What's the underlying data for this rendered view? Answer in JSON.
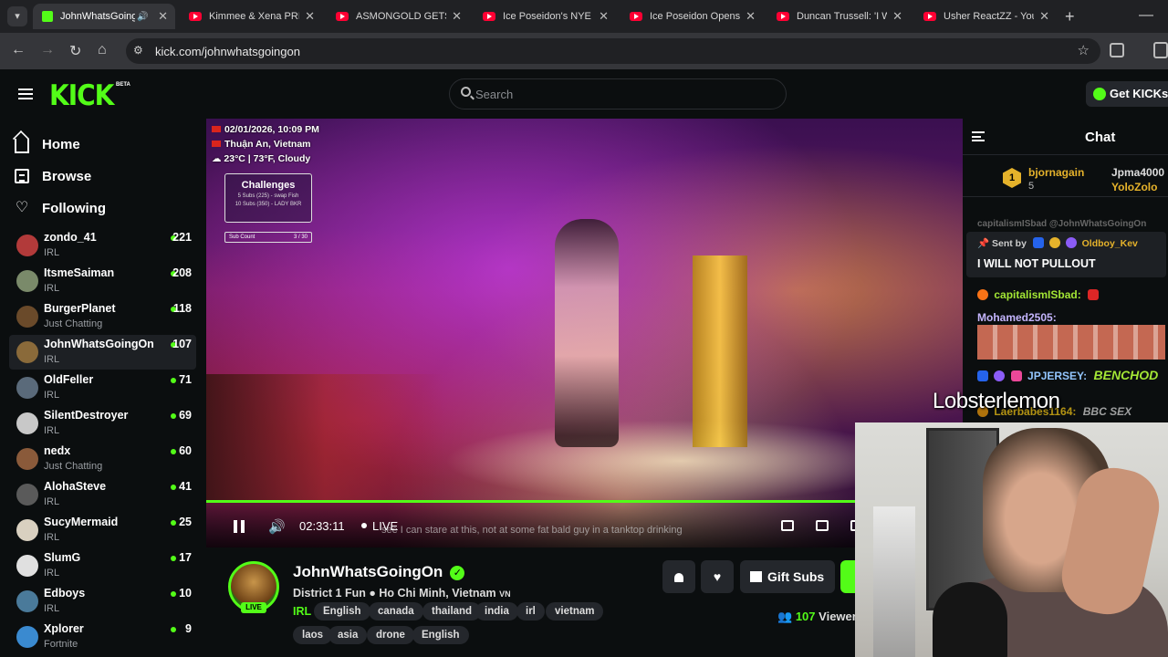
{
  "browser": {
    "tabs": [
      {
        "title": "JohnWhatsGoingOn",
        "active": true,
        "icon": "kick-favicon"
      },
      {
        "title": "Kimmee & Xena PRE",
        "icon": "youtube-favicon"
      },
      {
        "title": "ASMONGOLD GETS A",
        "icon": "youtube-favicon"
      },
      {
        "title": "Ice Poseidon's NYE L",
        "icon": "youtube-favicon"
      },
      {
        "title": "Ice Poseidon Opens",
        "icon": "youtube-favicon"
      },
      {
        "title": "Duncan Trussell: 'I W",
        "icon": "youtube-favicon"
      },
      {
        "title": "Usher ReactZZ - You",
        "icon": "youtube-favicon"
      }
    ],
    "url": "kick.com/johnwhatsgoingon"
  },
  "header": {
    "logo": "KICK",
    "logo_badge": "BETA",
    "search_placeholder": "Search",
    "get_kicks_label": "Get KICKs"
  },
  "sidebar": {
    "nav": [
      {
        "label": "Home",
        "icon": "home-icon"
      },
      {
        "label": "Browse",
        "icon": "browse-icon"
      },
      {
        "label": "Following",
        "icon": "heart-icon"
      }
    ],
    "channels": [
      {
        "name": "zondo_41",
        "category": "IRL",
        "viewers": "221",
        "color": "#b23a3a"
      },
      {
        "name": "ItsmeSaiman",
        "category": "IRL",
        "viewers": "208",
        "color": "#7a8a6a"
      },
      {
        "name": "BurgerPlanet",
        "category": "Just Chatting",
        "viewers": "118",
        "color": "#6a4a2a"
      },
      {
        "name": "JohnWhatsGoingOn",
        "category": "IRL",
        "viewers": "107",
        "color": "#8a6a3a",
        "active": true
      },
      {
        "name": "OldFeller",
        "category": "IRL",
        "viewers": "71",
        "color": "#5a6a7a"
      },
      {
        "name": "SilentDestroyer",
        "category": "IRL",
        "viewers": "69",
        "color": "#c8c8c8"
      },
      {
        "name": "nedx",
        "category": "Just Chatting",
        "viewers": "60",
        "color": "#8a5a3a"
      },
      {
        "name": "AlohaSteve",
        "category": "IRL",
        "viewers": "41",
        "color": "#5a5a5a"
      },
      {
        "name": "SucyMermaid",
        "category": "IRL",
        "viewers": "25",
        "color": "#d9d0c0"
      },
      {
        "name": "SlumG",
        "category": "IRL",
        "viewers": "17",
        "color": "#e0e0e0"
      },
      {
        "name": "Edboys",
        "category": "IRL",
        "viewers": "10",
        "color": "#4a7a9a"
      },
      {
        "name": "Xplorer",
        "category": "Fortnite",
        "viewers": "9",
        "color": "#3a8ad0"
      }
    ]
  },
  "video": {
    "overlay": {
      "datetime": "02/01/2026, 10:09 PM",
      "location": "Thuận An, Vietnam",
      "weather": "23°C | 73°F, Cloudy",
      "challenges_title": "Challenges",
      "challenge_lines": [
        "5 Subs (225) - swap Fish",
        "10 Subs (350) - LADY BKR"
      ],
      "sub_count_label": "Sub Count",
      "sub_count_value": "3 / 30"
    },
    "caption": "see I can stare at this, not at some fat bald guy in a tanktop drinking",
    "watermark": "JohnWhatsGoingOn",
    "progress": 1.0,
    "time": "02:33:11",
    "live_label": "LIVE"
  },
  "chat": {
    "title": "Chat",
    "top_gifters": [
      {
        "name": "bjornagain",
        "count": "5",
        "rank": "1"
      },
      {
        "name": "Jpma4000"
      },
      {
        "name": "YoloZolo"
      }
    ],
    "truncated_line": "capitalismISbad @JohnWhatsGoingOn",
    "pinned": {
      "sent_by_label": "Sent by",
      "user": "Oldboy_Kev",
      "message": "I WILL NOT PULLOUT"
    },
    "messages": [
      {
        "user": "capitalismISbad:",
        "color": "#a3e635"
      },
      {
        "user": "Mohamed2505:",
        "color": "#c4b5fd"
      },
      {
        "user": "JPJERSEY:",
        "color": "#93c5fd",
        "text": "BENCHOD"
      },
      {
        "user": "Laerbabes1164:",
        "color": "#facc15",
        "text": "BBC SEX"
      }
    ],
    "overlay_name": "Lobsterlemon"
  },
  "channel": {
    "name": "JohnWhatsGoingOn",
    "live_badge": "LIVE",
    "title": "District 1 Fun ● Ho Chi Minh, Vietnam",
    "title_flag": "VN",
    "category": "IRL",
    "tags": [
      "English",
      "canada",
      "thailand",
      "india",
      "irl",
      "vietnam",
      "laos",
      "asia",
      "drone",
      "English"
    ],
    "gift_subs_label": "Gift Subs",
    "viewer_count": "107",
    "viewers_label": "Viewers"
  }
}
